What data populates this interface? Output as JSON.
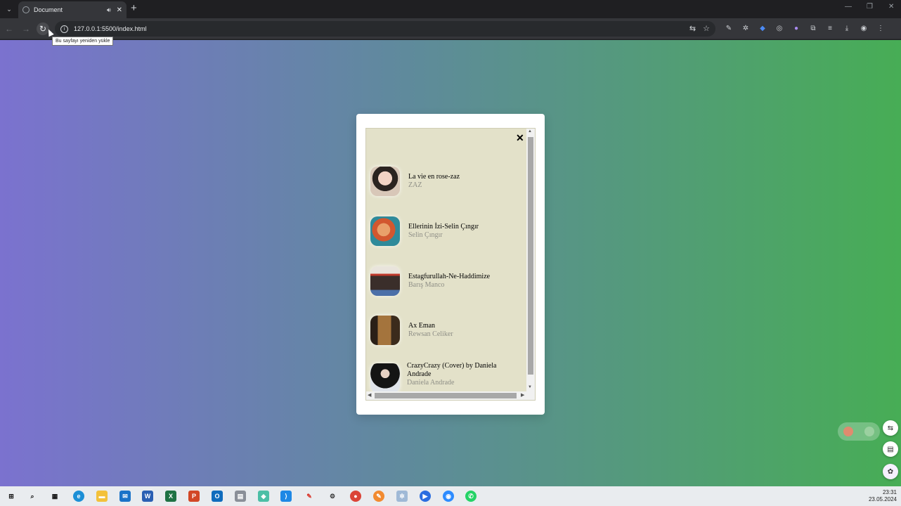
{
  "browser": {
    "tab_title": "Document",
    "url": "127.0.0.1:5500/index.html",
    "reload_tooltip": "Bu sayfayı yeniden yükle"
  },
  "playlist": {
    "songs": [
      {
        "title": "La vie en rose-zaz",
        "artist": "ZAZ"
      },
      {
        "title": "Ellerinin İzi-Selin Çıngır",
        "artist": "Selin Çıngır"
      },
      {
        "title": "Estagfurullah-Ne-Haddimize",
        "artist": "Barış Manco"
      },
      {
        "title": "Ax Eman",
        "artist": "Rewsan Celiker"
      },
      {
        "title": "CrazyCrazy (Cover) by Daniela Andrade",
        "artist": "Daniela Andrade"
      }
    ],
    "close_label": "✕"
  },
  "taskbar": {
    "time": "23:31",
    "date": "23.05.2024"
  },
  "colors": {
    "gradient_left": "#7b72cf",
    "gradient_right": "#47ad55",
    "playlist_bg": "#e3e1c9"
  }
}
